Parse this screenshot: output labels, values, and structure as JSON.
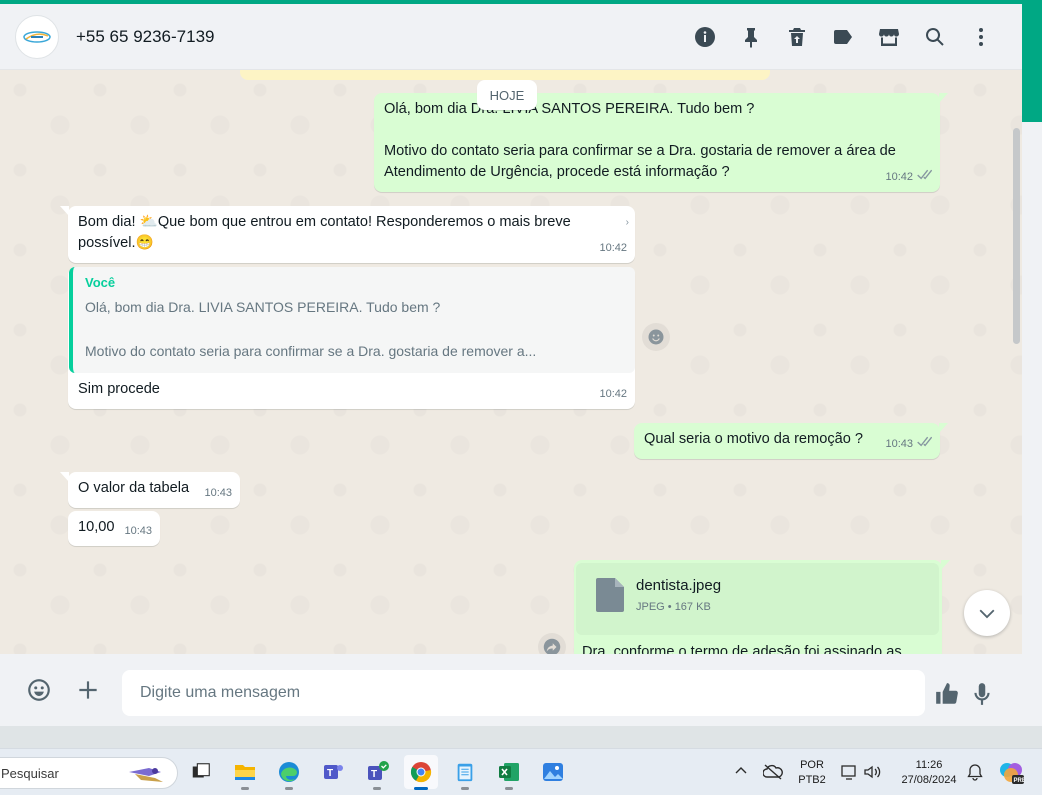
{
  "header": {
    "contact_name": "+55 65 9236-7139",
    "icons": [
      "info-icon",
      "pin-icon",
      "trash-icon",
      "label-icon",
      "store-icon",
      "search-icon",
      "menu-icon"
    ]
  },
  "chat": {
    "day_chip": "HOJE",
    "messages": [
      {
        "direction": "out",
        "line1": "Olá, bom dia Dra. LIVIA SANTOS PEREIRA. Tudo bem ?",
        "line2": "Motivo do contato seria para confirmar se a Dra.  gostaria de remover a área de",
        "line3": "Atendimento de Urgência, procede está informação ?",
        "time": "10:42"
      },
      {
        "direction": "in",
        "line1_a": "Bom dia! ",
        "line1_b": "Que bom que entrou em contato! Responderemos o mais breve",
        "line2": "possível.",
        "time": "10:42"
      },
      {
        "direction": "in",
        "quote_author": "Você",
        "quote_line1": "Olá, bom dia Dra. LIVIA SANTOS PEREIRA. Tudo bem ?",
        "quote_line2": "Motivo do contato seria para confirmar se a Dra.  gostaria de remover a...",
        "text": "Sim procede",
        "time": "10:42"
      },
      {
        "direction": "out",
        "text": "Qual seria o motivo da remoção ?",
        "time": "10:43"
      },
      {
        "direction": "in",
        "text": "O valor da tabela",
        "time": "10:43"
      },
      {
        "direction": "in",
        "text": "10,00",
        "time": "10:43"
      },
      {
        "direction": "out",
        "doc_name": "dentista.jpeg",
        "doc_info": "JPEG • 167 KB",
        "caption_partial": "Dra, conforme o termo de adesão foi assinado as"
      }
    ]
  },
  "footer": {
    "placeholder": "Digite uma mensagem"
  },
  "taskbar": {
    "search_text": "Pesquisar",
    "lang1": "POR",
    "lang2": "PTB2",
    "time": "11:26",
    "date": "27/08/2024"
  },
  "colors": {
    "accent": "#00a884",
    "outgoing_bubble": "#d9fdd3",
    "incoming_bubble": "#ffffff",
    "chat_bg": "#efeae2"
  }
}
